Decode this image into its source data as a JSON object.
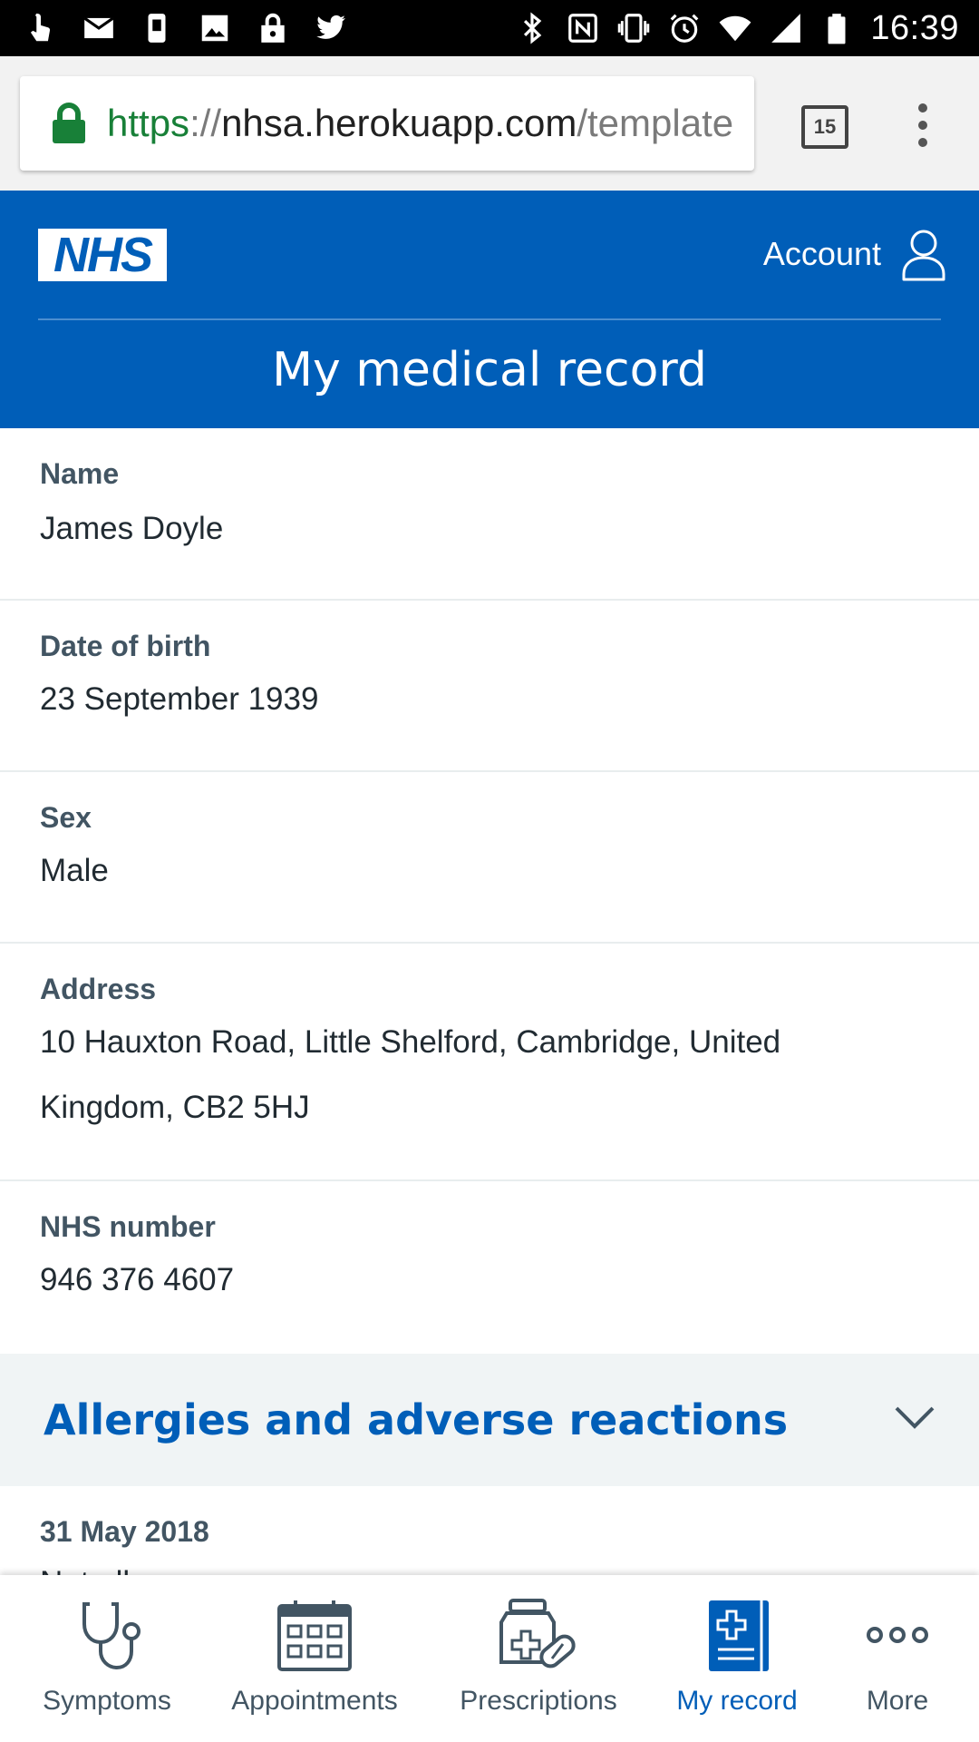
{
  "status_bar": {
    "time": "16:39",
    "left_icons": [
      "touch-icon",
      "mail-icon",
      "phone-icon",
      "image-icon",
      "lock-icon",
      "twitter-icon"
    ],
    "right_icons": [
      "bluetooth-icon",
      "nfc-icon",
      "vibrate-icon",
      "alarm-icon",
      "wifi-icon",
      "signal-icon",
      "battery-icon"
    ]
  },
  "browser": {
    "url_scheme": "https",
    "url_separator": "://",
    "url_host": "nhsa.herokuapp.com",
    "url_path": "/template",
    "tab_count": "15"
  },
  "header": {
    "logo_text": "NHS",
    "account_label": "Account",
    "page_title": "My medical record"
  },
  "record": {
    "fields": [
      {
        "label": "Name",
        "value_lines": [
          "James Doyle"
        ]
      },
      {
        "label": "Date of birth",
        "value_lines": [
          "23 September 1939"
        ]
      },
      {
        "label": "Sex",
        "value_lines": [
          "Male"
        ]
      },
      {
        "label": "Address",
        "value_lines": [
          "10 Hauxton Road, Little Shelford, Cambridge, United",
          "Kingdom, CB2 5HJ"
        ]
      },
      {
        "label": "NHS number",
        "value_lines": [
          "946 376 4607"
        ]
      }
    ]
  },
  "allergies": {
    "title": "Allergies and adverse reactions",
    "entry_date": "31 May 2018",
    "entry_partial_text": "Not all"
  },
  "bottom_nav": {
    "items": [
      {
        "label": "Symptoms",
        "icon": "stethoscope-icon",
        "active": false
      },
      {
        "label": "Appointments",
        "icon": "calendar-icon",
        "active": false
      },
      {
        "label": "Prescriptions",
        "icon": "pills-icon",
        "active": false
      },
      {
        "label": "My record",
        "icon": "medical-record-icon",
        "active": true
      },
      {
        "label": "More",
        "icon": "more-icon",
        "active": false
      }
    ]
  },
  "colors": {
    "nhs_blue": "#005eb8",
    "text_dark": "#212b32",
    "label_grey": "#425563",
    "section_bg": "#f0f4f5",
    "url_green": "#188038"
  }
}
